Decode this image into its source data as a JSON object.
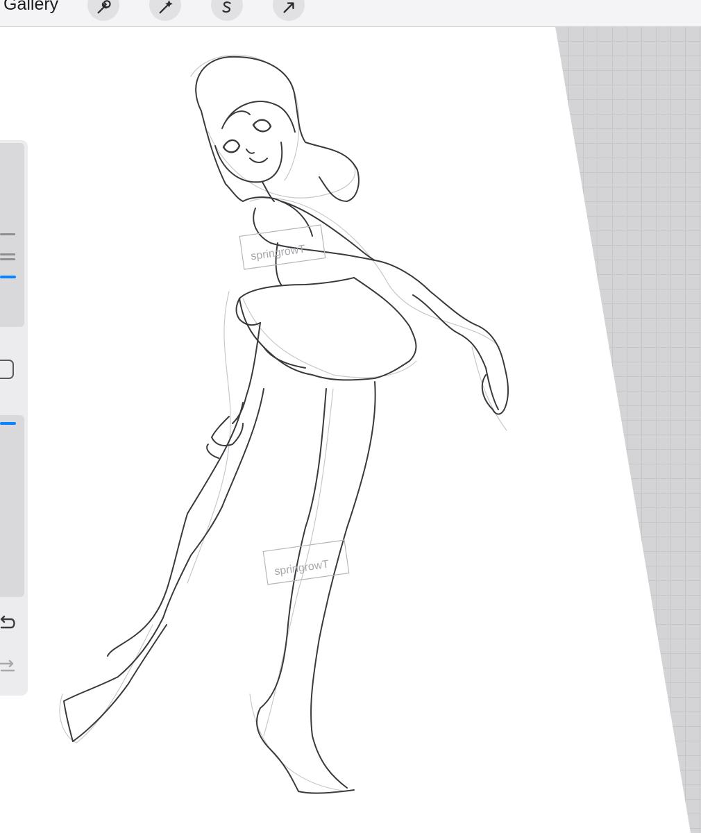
{
  "toolbar": {
    "gallery_label": "Gallery",
    "tools": [
      {
        "icon": "wrench-icon"
      },
      {
        "icon": "magic-wand-icon"
      },
      {
        "icon": "selection-s-icon"
      },
      {
        "icon": "transform-arrow-icon"
      }
    ]
  },
  "sidebar": {
    "controls": [
      "brush-size-slider",
      "modify-button",
      "brush-opacity-slider",
      "undo-button",
      "redo-button"
    ],
    "accent_color": "#0a84ff"
  },
  "artwork": {
    "subject": "pencil sketch of a girl in a skirt looking back over her shoulder",
    "watermark_text": "springrowT"
  }
}
